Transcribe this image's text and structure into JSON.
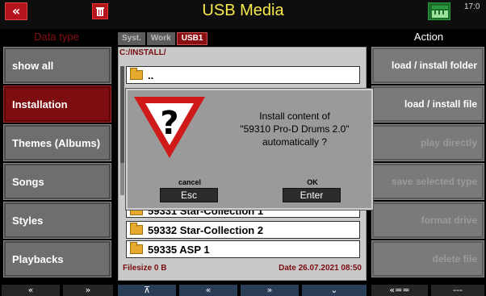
{
  "window": {
    "title": "USB Media",
    "clock": "17:0"
  },
  "left_panel": {
    "header": "Data type",
    "items": [
      {
        "label": "show all",
        "active": false
      },
      {
        "label": "Installation",
        "active": true
      },
      {
        "label": "Themes (Albums)",
        "active": false
      },
      {
        "label": "Songs",
        "active": false
      },
      {
        "label": "Styles",
        "active": false
      },
      {
        "label": "Playbacks",
        "active": false
      }
    ]
  },
  "right_panel": {
    "header": "Action",
    "items": [
      {
        "label": "load  /  install folder",
        "enabled": true
      },
      {
        "label": "load  /  install file",
        "enabled": true
      },
      {
        "label": "play  directly",
        "enabled": false
      },
      {
        "label": "save  selected  type",
        "enabled": false
      },
      {
        "label": "format  drive",
        "enabled": false
      },
      {
        "label": "delete  file",
        "enabled": false
      }
    ]
  },
  "tabs": [
    {
      "label": "Syst.",
      "active": false
    },
    {
      "label": "Work",
      "active": false
    },
    {
      "label": "USB1",
      "active": true
    }
  ],
  "browser": {
    "path": "C:/INSTALL/",
    "parent_entry": "..",
    "entries": [
      "59331 Star-Collection 1",
      "59332 Star-Collection 2",
      "59335 ASP 1"
    ],
    "filesize": "Filesize  0 B",
    "date": "Date  26.07.2021   08:50"
  },
  "dialog": {
    "message_lines": [
      "Install content of",
      "\"59310 Pro-D Drums 2.0\"",
      "automatically ?"
    ],
    "cancel_label": "cancel",
    "cancel_key": "Esc",
    "ok_label": "OK",
    "ok_key": "Enter"
  },
  "bottom_buttons": [
    "«",
    "»",
    "⊼",
    "«",
    "»",
    "⌄",
    "«==",
    "---"
  ],
  "colors": {
    "accent": "#8a0e12",
    "title": "#f7e84b",
    "panel": "#6e6e6e"
  }
}
